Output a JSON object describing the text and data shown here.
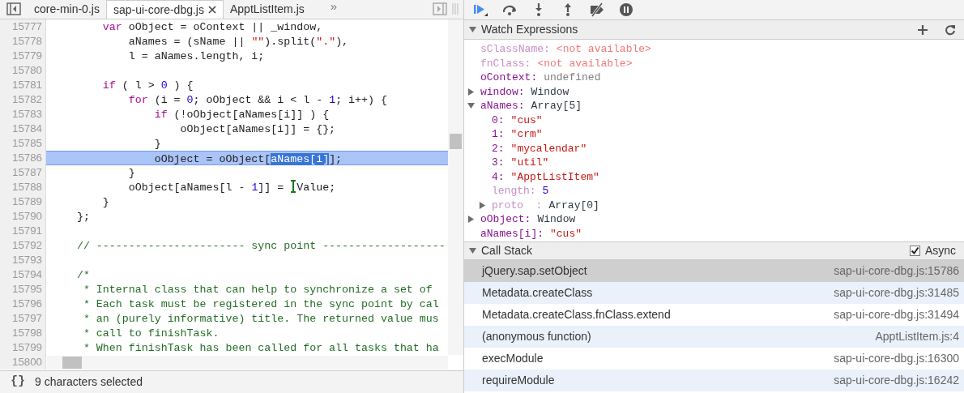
{
  "editor": {
    "tabs": [
      {
        "label": "core-min-0.js",
        "selected": false
      },
      {
        "label": "sap-ui-core-dbg.js",
        "selected": true
      },
      {
        "label": "ApptListItem.js",
        "selected": false
      }
    ],
    "overflow": "»",
    "lines": [
      {
        "number": "15777",
        "highlighted": false,
        "tokens": [
          {
            "kind": "keyword",
            "text": "        var"
          },
          {
            "kind": "plain",
            "text": " oObject = oContext || _window,"
          }
        ]
      },
      {
        "number": "15778",
        "highlighted": false,
        "tokens": [
          {
            "kind": "plain",
            "text": "            aNames = (sName || "
          },
          {
            "kind": "string",
            "text": "\"\""
          },
          {
            "kind": "plain",
            "text": ").split("
          },
          {
            "kind": "string",
            "text": "\".\""
          },
          {
            "kind": "plain",
            "text": "),"
          }
        ]
      },
      {
        "number": "15779",
        "highlighted": false,
        "tokens": [
          {
            "kind": "plain",
            "text": "            l = aNames.length, i;"
          }
        ]
      },
      {
        "number": "15780",
        "highlighted": false
      },
      {
        "number": "15781",
        "highlighted": false,
        "tokens": [
          {
            "kind": "keyword",
            "text": "        if"
          },
          {
            "kind": "plain",
            "text": " ( l > "
          },
          {
            "kind": "number",
            "text": "0"
          },
          {
            "kind": "plain",
            "text": " ) {"
          }
        ]
      },
      {
        "number": "15782",
        "highlighted": false,
        "tokens": [
          {
            "kind": "keyword",
            "text": "            for"
          },
          {
            "kind": "plain",
            "text": " (i = "
          },
          {
            "kind": "number",
            "text": "0"
          },
          {
            "kind": "plain",
            "text": "; oObject && i < l - "
          },
          {
            "kind": "number",
            "text": "1"
          },
          {
            "kind": "plain",
            "text": "; i++) {"
          }
        ]
      },
      {
        "number": "15783",
        "highlighted": false,
        "tokens": [
          {
            "kind": "keyword",
            "text": "                if"
          },
          {
            "kind": "plain",
            "text": " (!oObject[aNames[i]] ) {"
          }
        ]
      },
      {
        "number": "15784",
        "highlighted": false,
        "tokens": [
          {
            "kind": "plain",
            "text": "                    oObject[aNames[i]] = {};"
          }
        ]
      },
      {
        "number": "15785",
        "highlighted": false,
        "tokens": [
          {
            "kind": "plain",
            "text": "                }"
          }
        ]
      },
      {
        "number": "15786",
        "highlighted": true,
        "tokens": [
          {
            "kind": "plain",
            "text": "                oObject = oObject["
          },
          {
            "kind": "selection",
            "text": "aNames[i]"
          },
          {
            "kind": "plain",
            "text": "];"
          }
        ]
      },
      {
        "number": "15787",
        "highlighted": false,
        "tokens": [
          {
            "kind": "plain",
            "text": "            }"
          }
        ]
      },
      {
        "number": "15788",
        "highlighted": false,
        "tokens": [
          {
            "kind": "plain",
            "text": "            oObject[aNames[l - "
          },
          {
            "kind": "number",
            "text": "1"
          },
          {
            "kind": "plain",
            "text": "]] = "
          },
          {
            "kind": "cursor"
          },
          {
            "kind": "plain",
            "text": "Value;"
          }
        ]
      },
      {
        "number": "15789",
        "highlighted": false,
        "tokens": [
          {
            "kind": "plain",
            "text": "        }"
          }
        ]
      },
      {
        "number": "15790",
        "highlighted": false,
        "tokens": [
          {
            "kind": "plain",
            "text": "    };"
          }
        ]
      },
      {
        "number": "15791",
        "highlighted": false
      },
      {
        "number": "15792",
        "highlighted": false,
        "tokens": [
          {
            "kind": "comment",
            "text": "    // ----------------------- sync point -------------------"
          }
        ]
      },
      {
        "number": "15793",
        "highlighted": false
      },
      {
        "number": "15794",
        "highlighted": false,
        "tokens": [
          {
            "kind": "comment",
            "text": "    /*"
          }
        ]
      },
      {
        "number": "15795",
        "highlighted": false,
        "tokens": [
          {
            "kind": "comment",
            "text": "     * Internal class that can help to synchronize a set of"
          }
        ]
      },
      {
        "number": "15796",
        "highlighted": false,
        "tokens": [
          {
            "kind": "comment",
            "text": "     * Each task must be registered in the sync point by cal"
          }
        ]
      },
      {
        "number": "15797",
        "highlighted": false,
        "tokens": [
          {
            "kind": "comment",
            "text": "     * an (purely informative) title. The returned value mus"
          }
        ]
      },
      {
        "number": "15798",
        "highlighted": false,
        "tokens": [
          {
            "kind": "comment",
            "text": "     * call to finishTask."
          }
        ]
      },
      {
        "number": "15799",
        "highlighted": false,
        "tokens": [
          {
            "kind": "comment",
            "text": "     * When finishTask has been called for all tasks that ha"
          }
        ]
      },
      {
        "number": "15800",
        "highlighted": false
      }
    ],
    "status_bar": {
      "pretty_print": "{}",
      "text": "9 characters selected"
    }
  },
  "watch": {
    "title": "Watch Expressions",
    "expanded": true,
    "entries": [
      {
        "name": "sClassName:",
        "value": "<not available>",
        "kind": "unavailable",
        "dimmed": true
      },
      {
        "name": "fnClass:",
        "value": "<not available>",
        "kind": "unavailable",
        "dimmed": true
      },
      {
        "name": "oContext:",
        "value": "undefined",
        "kind": "undefined",
        "dimmed": false
      },
      {
        "name": "window:",
        "value": "Window",
        "kind": "object",
        "dimmed": false,
        "expanded": false
      },
      {
        "name": "aNames:",
        "value": "Array[5]",
        "kind": "object",
        "dimmed": false,
        "expanded": true,
        "children": [
          {
            "name": "0:",
            "value": "\"cus\"",
            "kind": "string",
            "dimmed": false
          },
          {
            "name": "1:",
            "value": "\"crm\"",
            "kind": "string",
            "dimmed": false
          },
          {
            "name": "2:",
            "value": "\"mycalendar\"",
            "kind": "string",
            "dimmed": false
          },
          {
            "name": "3:",
            "value": "\"util\"",
            "kind": "string",
            "dimmed": false
          },
          {
            "name": "4:",
            "value": "\"ApptListItem\"",
            "kind": "string",
            "dimmed": false
          },
          {
            "name": "length:",
            "value": "5",
            "kind": "number",
            "dimmed": true
          },
          {
            "name": "proto  :",
            "value": "Array[0]",
            "kind": "object",
            "dimmed": true,
            "expanded": false
          }
        ]
      },
      {
        "name": "oObject:",
        "value": "Window",
        "kind": "object",
        "dimmed": false,
        "expanded": false
      },
      {
        "name": "aNames[i]:",
        "value": "\"cus\"",
        "kind": "string",
        "dimmed": false
      }
    ]
  },
  "call_stack": {
    "title": "Call Stack",
    "expanded": true,
    "async": {
      "label": "Async",
      "checked": true
    },
    "frames": [
      {
        "function": "jQuery.sap.setObject",
        "location": "sap-ui-core-dbg.js:15786",
        "selected": true
      },
      {
        "function": "Metadata.createClass",
        "location": "sap-ui-core-dbg.js:31485",
        "selected": false
      },
      {
        "function": "Metadata.createClass.fnClass.extend",
        "location": "sap-ui-core-dbg.js:31494",
        "selected": false
      },
      {
        "function": "(anonymous function)",
        "location": "ApptListItem.js:4",
        "selected": false
      },
      {
        "function": "execModule",
        "location": "sap-ui-core-dbg.js:16300",
        "selected": false
      },
      {
        "function": "requireModule",
        "location": "sap-ui-core-dbg.js:16242",
        "selected": false
      }
    ]
  }
}
